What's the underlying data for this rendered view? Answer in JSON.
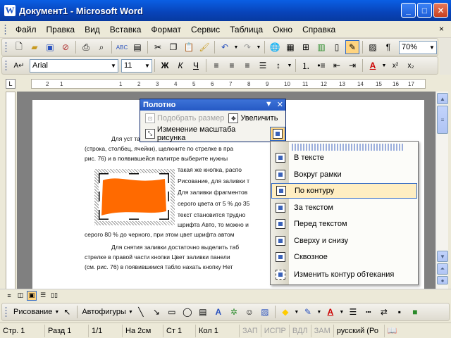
{
  "window": {
    "title": "Документ1 - Microsoft Word",
    "app_icon_letter": "W"
  },
  "menu": {
    "items": [
      "Файл",
      "Правка",
      "Вид",
      "Вставка",
      "Формат",
      "Сервис",
      "Таблица",
      "Окно",
      "Справка"
    ],
    "close_glyph": "×"
  },
  "toolbar_standard": {
    "zoom": "70%"
  },
  "toolbar_format": {
    "font": "Arial",
    "size": "11",
    "bold": "Ж",
    "italic": "К",
    "underline": "Ч"
  },
  "ruler": {
    "ticks": [
      "1",
      "2",
      "1",
      "2",
      "3",
      "4",
      "5",
      "6",
      "7",
      "8",
      "9",
      "10",
      "11",
      "12",
      "13",
      "14",
      "15",
      "16",
      "17"
    ]
  },
  "document": {
    "lines": [
      "Для уст                                                              табли",
      "(строка, столбец, ячейки), щелкните по стрелке в пра",
      "рис. 76) и в появившейся палитре выберите нужны",
      "такая же кнопка, распо",
      "Рисование, для заливки т",
      "Для заливки фрагментов",
      "серого цвета от 5 % до 35",
      "текст становится трудно",
      "шрифта Авто, то можно и",
      "серого 80 % до черного, при этом цвет шрифта автом",
      "Для снятия заливки достаточно выделить таб",
      "стрелке в правой части кнопки Цвет заливки панели",
      "(см. рис. 76) в появившемся табло нахать кнопку Нет"
    ]
  },
  "canvas_toolbar": {
    "title": "Полотно",
    "fit_label": "Подобрать размер",
    "enlarge_label": "Увеличить",
    "scale_label": "Изменение масштаба рисунка"
  },
  "wrap_menu": {
    "items": [
      {
        "label": "В тексте",
        "highlighted": false
      },
      {
        "label": "Вокруг рамки",
        "highlighted": false
      },
      {
        "label": "По контуру",
        "highlighted": true
      },
      {
        "label": "За текстом",
        "highlighted": false
      },
      {
        "label": "Перед текстом",
        "highlighted": false
      },
      {
        "label": "Сверху и снизу",
        "highlighted": false
      },
      {
        "label": "Сквозное",
        "highlighted": false
      },
      {
        "label": "Изменить контур обтекания",
        "highlighted": false
      }
    ]
  },
  "drawbar": {
    "draw_label": "Рисование",
    "autoshapes_label": "Автофигуры"
  },
  "statusbar": {
    "page": "Стр. 1",
    "section": "Разд 1",
    "pages": "1/1",
    "at": "На 2см",
    "line": "Ст 1",
    "col": "Кол 1",
    "rec": "ЗАП",
    "trk": "ИСПР",
    "ext": "ВДЛ",
    "ovr": "ЗАМ",
    "lang": "русский (Ро"
  },
  "colors": {
    "shape_fill": "#ff6a00",
    "title_bar": "#0843b8",
    "highlight": "#ffeec2"
  }
}
